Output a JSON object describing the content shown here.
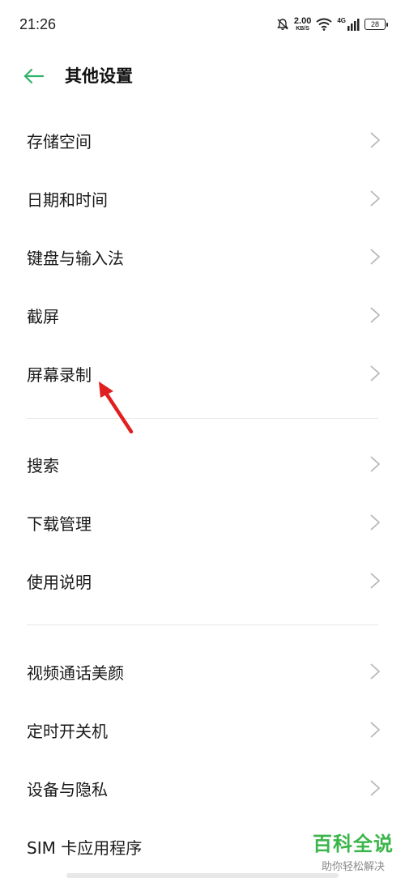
{
  "status_bar": {
    "time": "21:26",
    "speed_value": "2.00",
    "speed_unit": "KB/S",
    "network": "4G",
    "battery": "28",
    "icons": [
      "bell-off-icon",
      "wifi-icon",
      "signal-icon",
      "battery-icon"
    ]
  },
  "header": {
    "title": "其他设置",
    "back_icon": "arrow-left-icon",
    "accent_color": "#2fb36b"
  },
  "groups": [
    {
      "items": [
        {
          "label": "存储空间"
        },
        {
          "label": "日期和时间"
        },
        {
          "label": "键盘与输入法"
        },
        {
          "label": "截屏"
        },
        {
          "label": "屏幕录制"
        }
      ]
    },
    {
      "items": [
        {
          "label": "搜索"
        },
        {
          "label": "下载管理"
        },
        {
          "label": "使用说明"
        }
      ]
    },
    {
      "items": [
        {
          "label": "视频通话美颜"
        },
        {
          "label": "定时开关机"
        },
        {
          "label": "设备与隐私"
        },
        {
          "label": "SIM 卡应用程序"
        }
      ]
    }
  ],
  "annotation": {
    "arrow_color": "#e02020"
  },
  "watermark": {
    "title": "百科全说",
    "subtitle": "助你轻松解决"
  }
}
